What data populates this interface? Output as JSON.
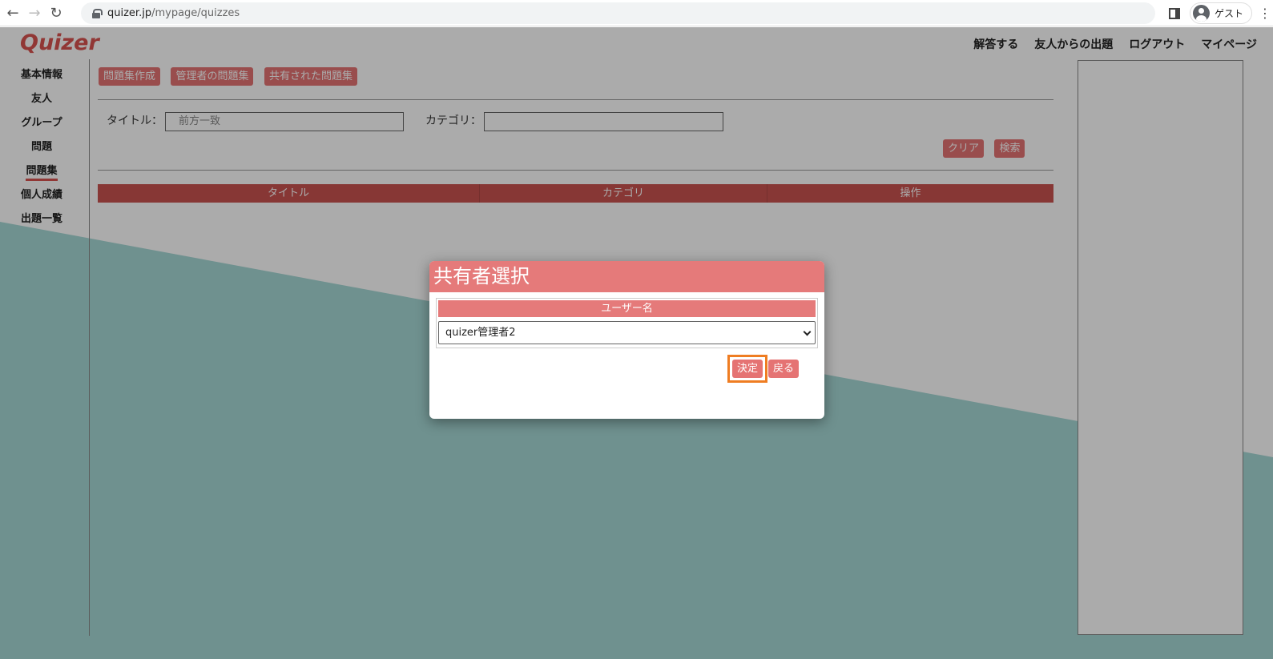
{
  "browser": {
    "url_host": "quizer.jp",
    "url_path": "/mypage/quizzes",
    "profile_label": "ゲスト"
  },
  "header": {
    "logo": "Quizer",
    "nav": [
      "解答する",
      "友人からの出題",
      "ログアウト",
      "マイページ"
    ]
  },
  "sidebar": {
    "items": [
      "基本情報",
      "友人",
      "グループ",
      "問題",
      "問題集",
      "個人成績",
      "出題一覧"
    ],
    "active": "問題集"
  },
  "toolbar": {
    "create_label": "問題集作成",
    "admin_label": "管理者の問題集",
    "shared_label": "共有された問題集"
  },
  "search": {
    "title_label": "タイトル：",
    "title_placeholder": "前方一致",
    "category_label": "カテゴリ：",
    "category_value": "",
    "clear_label": "クリア",
    "search_label": "検索"
  },
  "table": {
    "headers": [
      "タイトル",
      "カテゴリ",
      "操作"
    ]
  },
  "modal": {
    "title": "共有者選択",
    "column_header": "ユーザー名",
    "selected_user": "quizer管理者2",
    "decide_label": "決定",
    "back_label": "戻る"
  },
  "colors": {
    "accent": "#e57373",
    "highlight": "#ef7d22",
    "teal": "#6fa3a2"
  }
}
